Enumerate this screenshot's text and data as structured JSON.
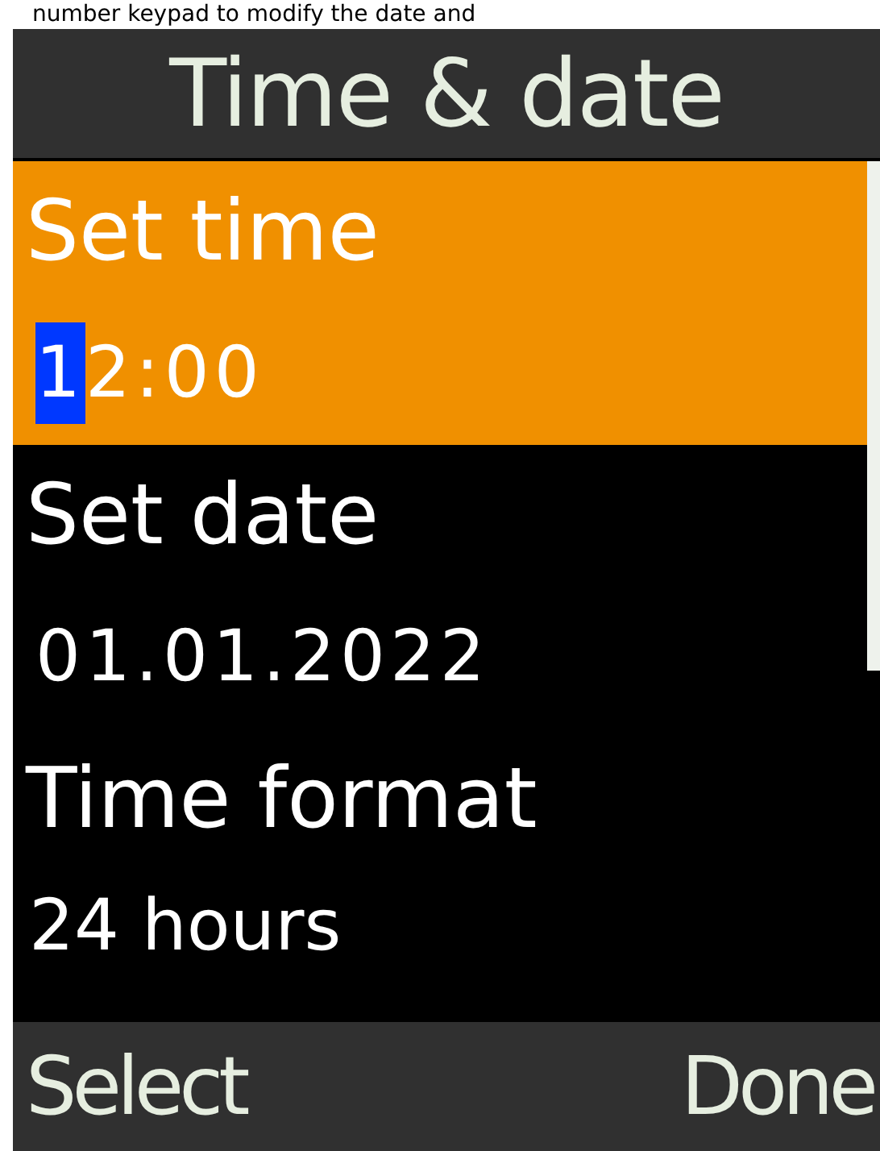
{
  "caption": "number keypad to modify the date and",
  "header": {
    "title": "Time & date"
  },
  "items": [
    {
      "label": "Set time",
      "value": "12:00",
      "selected": true,
      "editing": true
    },
    {
      "label": "Set date",
      "value": "01.01.2022",
      "selected": false,
      "editing": false
    },
    {
      "label": "Time format",
      "value": "24 hours",
      "selected": false,
      "editing": false
    }
  ],
  "softkeys": {
    "left": "Select",
    "right": "Done"
  }
}
